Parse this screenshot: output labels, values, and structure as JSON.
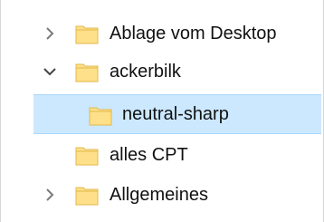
{
  "tree": {
    "items": [
      {
        "label": "Ablage vom Desktop",
        "expander": "chevron-right",
        "selected": false
      },
      {
        "label": "ackerbilk",
        "expander": "chevron-down",
        "selected": false
      },
      {
        "label": "neutral-sharp",
        "expander": "",
        "selected": true
      },
      {
        "label": "alles CPT",
        "expander": "",
        "selected": false
      },
      {
        "label": "Allgemeines",
        "expander": "chevron-right",
        "selected": false
      }
    ]
  },
  "colors": {
    "selection_bg": "#cce8ff",
    "selection_border": "#a9d7fb",
    "folder_fill": "#ffe08a",
    "folder_outline": "#e2b84b",
    "chevron": "#7a7a7a"
  }
}
